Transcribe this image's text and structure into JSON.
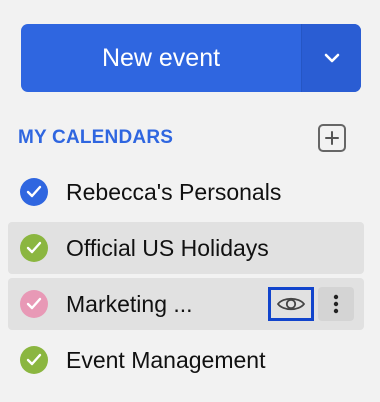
{
  "new_event": {
    "label": "New event",
    "dropdown_icon": "chevron-down-icon"
  },
  "section": {
    "title": "MY CALENDARS",
    "add_icon": "plus-box-icon"
  },
  "calendars": [
    {
      "name": "Rebecca's Personals",
      "color": "#2f66e0",
      "checked": true
    },
    {
      "name": "Official US Holidays",
      "color": "#8bb640",
      "checked": true
    },
    {
      "name": "Marketing ...",
      "color": "#e899b6",
      "checked": true
    },
    {
      "name": "Event Management",
      "color": "#8bb640",
      "checked": true
    }
  ],
  "row_actions": {
    "visibility_icon": "eye-icon",
    "more_icon": "vertical-dots-icon"
  },
  "colors": {
    "accent": "#2f66e0",
    "focus_outline": "#1144cc"
  }
}
